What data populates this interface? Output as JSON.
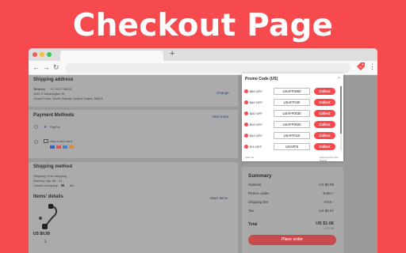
{
  "banner": {
    "title": "Checkout Page"
  },
  "browser": {
    "new_tab": "+",
    "nav": {
      "back": "←",
      "forward": "→",
      "reload": "↻"
    },
    "menu": "⋮"
  },
  "shipping_address": {
    "title": "Shipping address",
    "name": "Terence",
    "phone": "+1 7017730231",
    "street": "1125 S Washington St",
    "city": "Grand Forks, North Dakota, United States, 58201",
    "change": "Change"
  },
  "payment": {
    "title": "Payment Methods",
    "view_more": "View more",
    "options": [
      {
        "label": "PayPal"
      },
      {
        "label": "Add a new card"
      }
    ]
  },
  "shipping_method": {
    "title": "Shipping method",
    "line1": "Shipping: Free shipping",
    "line2": "Delivery: Apr 08 - 13",
    "line3": "Courier company:",
    "etc": "etc"
  },
  "items": {
    "title": "Items' details",
    "more": "More items",
    "price": "US $0.99",
    "qty": "1"
  },
  "promo": {
    "title": "Promo Code (US)",
    "close": "×",
    "codes": [
      {
        "off": "$60 OFF",
        "code": "USAFF0060",
        "action": "Collect"
      },
      {
        "off": "$40 OFF",
        "code": "USAFF040",
        "action": "Collect"
      },
      {
        "off": "$30 OFF",
        "code": "USAFF0030",
        "action": "Collect"
      },
      {
        "off": "$20 OFF",
        "code": "USAFF0020",
        "action": "Collect"
      },
      {
        "off": "$10 OFF",
        "code": "USAFF010",
        "action": "Collect"
      },
      {
        "off": "5% OFF",
        "code": "USAFF5",
        "action": "Collect"
      }
    ],
    "foot_left": "View 1st",
    "foot_right": "Sponsored by Ad-Saving"
  },
  "summary": {
    "title": "Summary",
    "rows": [
      {
        "label": "Subtotal",
        "value": "US $0.99"
      },
      {
        "label": "Promo codes",
        "value": "Enter ›"
      },
      {
        "label": "Shipping fee",
        "value": "Free ›"
      },
      {
        "label": "Tax",
        "value": "US $0.07"
      }
    ],
    "total_label": "Total",
    "total_value": "US $1.06",
    "total_sub": "≈ € 0.99",
    "place_order": "Place order"
  },
  "colors": {
    "accent": "#f64a4e"
  }
}
